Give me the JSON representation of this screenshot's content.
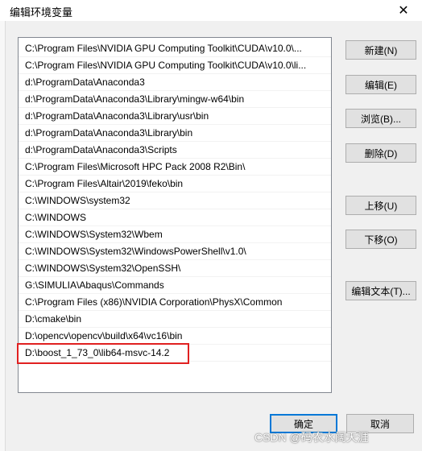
{
  "window": {
    "title": "编辑环境变量",
    "close_glyph": "✕"
  },
  "paths": [
    "C:\\Program Files\\NVIDIA GPU Computing Toolkit\\CUDA\\v10.0\\...",
    "C:\\Program Files\\NVIDIA GPU Computing Toolkit\\CUDA\\v10.0\\li...",
    "d:\\ProgramData\\Anaconda3",
    "d:\\ProgramData\\Anaconda3\\Library\\mingw-w64\\bin",
    "d:\\ProgramData\\Anaconda3\\Library\\usr\\bin",
    "d:\\ProgramData\\Anaconda3\\Library\\bin",
    "d:\\ProgramData\\Anaconda3\\Scripts",
    "C:\\Program Files\\Microsoft HPC Pack 2008 R2\\Bin\\",
    "C:\\Program Files\\Altair\\2019\\feko\\bin",
    "C:\\WINDOWS\\system32",
    "C:\\WINDOWS",
    "C:\\WINDOWS\\System32\\Wbem",
    "C:\\WINDOWS\\System32\\WindowsPowerShell\\v1.0\\",
    "C:\\WINDOWS\\System32\\OpenSSH\\",
    "G:\\SIMULIA\\Abaqus\\Commands",
    "C:\\Program Files (x86)\\NVIDIA Corporation\\PhysX\\Common",
    "D:\\cmake\\bin",
    "D:\\opencv\\opencv\\build\\x64\\vc16\\bin",
    "D:\\boost_1_73_0\\lib64-msvc-14.2"
  ],
  "buttons": {
    "new": "新建(N)",
    "edit": "编辑(E)",
    "browse": "浏览(B)...",
    "delete": "删除(D)",
    "move_up": "上移(U)",
    "move_down": "下移(O)",
    "edit_text": "编辑文本(T)...",
    "ok": "确定",
    "cancel": "取消"
  },
  "highlight_color": "#e02020",
  "watermark": "CSDN @码农水阔天涯"
}
